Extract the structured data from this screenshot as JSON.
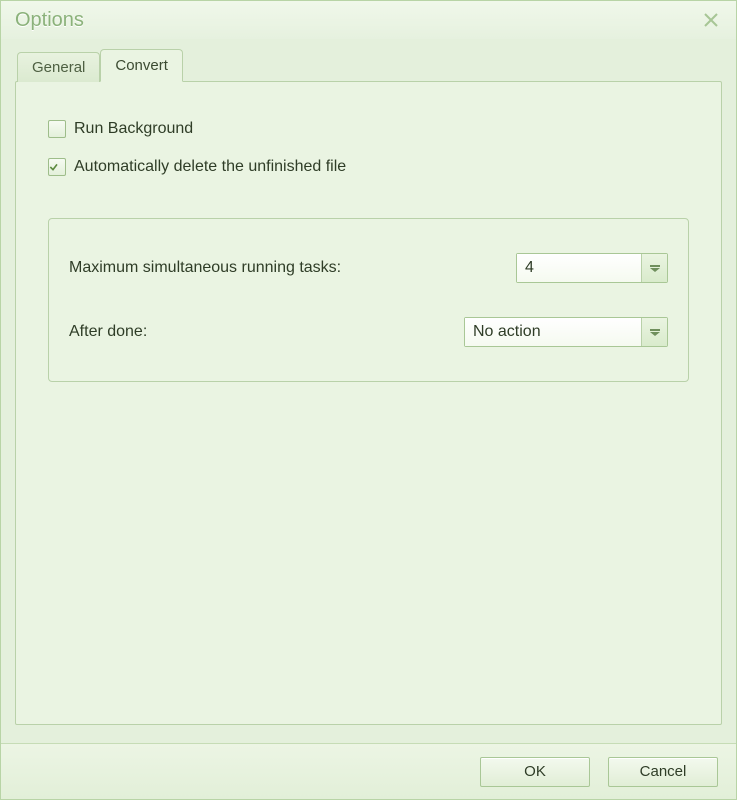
{
  "window": {
    "title": "Options"
  },
  "tabs": {
    "general": "General",
    "convert": "Convert",
    "active": "convert"
  },
  "convert": {
    "run_background_label": "Run Background",
    "run_background_checked": false,
    "auto_delete_label": "Automatically delete the unfinished file",
    "auto_delete_checked": true,
    "max_tasks_label": "Maximum simultaneous running tasks:",
    "max_tasks_value": "4",
    "after_done_label": "After done:",
    "after_done_value": "No action"
  },
  "buttons": {
    "ok": "OK",
    "cancel": "Cancel"
  }
}
